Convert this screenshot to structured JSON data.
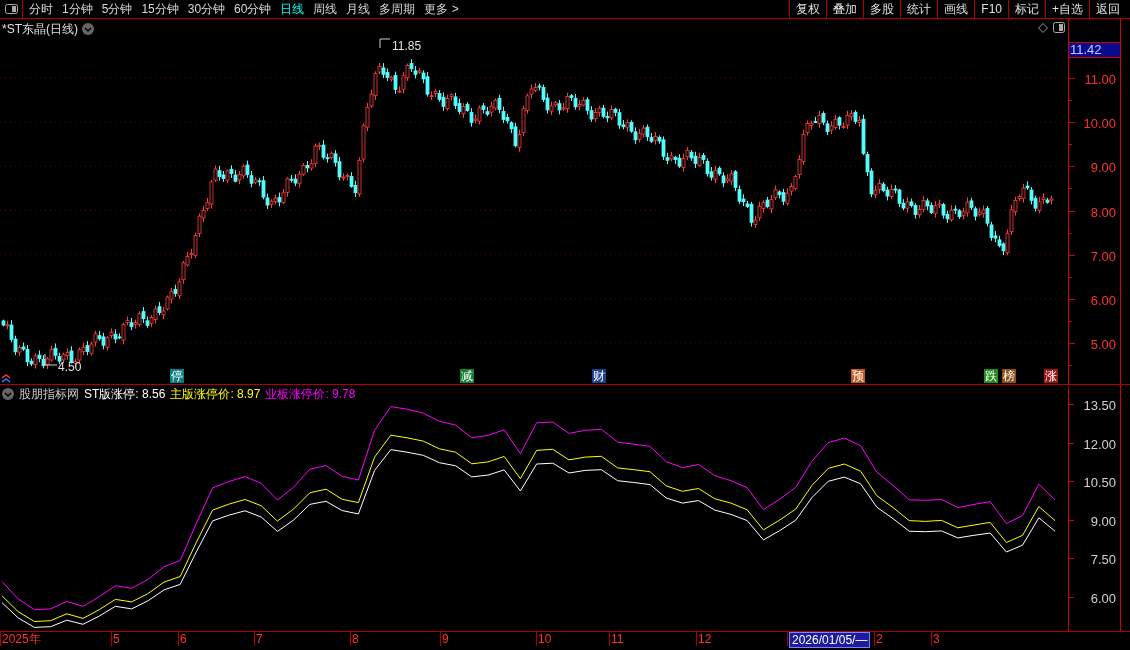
{
  "toolbar": {
    "periods": [
      {
        "label": "分时",
        "selected": false
      },
      {
        "label": "1分钟",
        "selected": false
      },
      {
        "label": "5分钟",
        "selected": false
      },
      {
        "label": "15分钟",
        "selected": false
      },
      {
        "label": "30分钟",
        "selected": false
      },
      {
        "label": "60分钟",
        "selected": false
      },
      {
        "label": "日线",
        "selected": true
      },
      {
        "label": "周线",
        "selected": false
      },
      {
        "label": "月线",
        "selected": false
      },
      {
        "label": "多周期",
        "selected": false
      },
      {
        "label": "更多 >",
        "selected": false
      }
    ],
    "actions": [
      "复权",
      "叠加",
      "多股",
      "统计",
      "画线",
      "F10",
      "标记",
      "+自选",
      "返回"
    ]
  },
  "chart": {
    "title": "*ST东晶(日线)",
    "current_price": "11.42",
    "price_axis": [
      "11.00",
      "10.00",
      "9.00",
      "8.00",
      "7.00",
      "6.00",
      "5.00"
    ],
    "high_label": "11.85",
    "low_label": "4.50",
    "markers": [
      {
        "text": "停",
        "color": "#0a7f80"
      },
      {
        "text": "减",
        "color": "#128030"
      },
      {
        "text": "财",
        "color": "#1c3f8c"
      },
      {
        "text": "预",
        "color": "#c0581a"
      },
      {
        "text": "跌",
        "color": "#1c8c1c"
      },
      {
        "text": "榜",
        "color": "#8c4c14"
      },
      {
        "text": "涨",
        "color": "#9a1418"
      }
    ]
  },
  "indicator": {
    "name": "股朋指标网",
    "legend": [
      ": 8.56",
      ": 8.97",
      ": 9.78"
    ],
    "chart_data": {
      "type": "line",
      "ylim": [
        4.72,
        14.24
      ],
      "yticks": [
        {
          "value": 13.5,
          "label": "13.50"
        },
        {
          "value": 12,
          "label": "12.00"
        },
        {
          "value": 10.5,
          "label": "10.50"
        },
        {
          "value": 9,
          "label": "9.00"
        },
        {
          "value": 7.5,
          "label": "7.50"
        },
        {
          "value": 6,
          "label": "6.00"
        }
      ],
      "series": [
        {
          "name": "ST版涨停",
          "color": "#ffffff",
          "values": [
            5.78,
            5.19,
            4.82,
            4.85,
            5.1,
            4.94,
            5.26,
            5.64,
            5.54,
            5.85,
            6.28,
            6.49,
            7.76,
            8.96,
            9.18,
            9.35,
            9.11,
            8.55,
            8.99,
            9.6,
            9.72,
            9.36,
            9.23,
            10.92,
            11.73,
            11.63,
            11.51,
            11.22,
            11.1,
            10.67,
            10.74,
            10.94,
            10.12,
            11.17,
            11.2,
            10.82,
            10.92,
            10.95,
            10.52,
            10.45,
            10.37,
            9.85,
            9.65,
            9.75,
            9.38,
            9.21,
            8.97,
            8.22,
            8.58,
            8.99,
            9.87,
            10.5,
            10.66,
            10.4,
            9.49,
            9.05,
            8.56,
            8.54,
            8.57,
            8.3,
            8.4,
            8.49,
            7.75,
            8.02,
            9.08,
            8.56
          ]
        },
        {
          "name": "主版涨停价",
          "color": "#ffff00",
          "values": [
            6.05,
            5.43,
            5.05,
            5.08,
            5.35,
            5.17,
            5.51,
            5.91,
            5.81,
            6.13,
            6.58,
            6.8,
            8.13,
            9.38,
            9.61,
            9.79,
            9.55,
            8.95,
            9.42,
            10.05,
            10.19,
            9.8,
            9.67,
            11.44,
            12.29,
            12.19,
            12.06,
            11.76,
            11.63,
            11.18,
            11.25,
            11.46,
            10.6,
            11.7,
            11.74,
            11.33,
            11.44,
            11.47,
            11.02,
            10.95,
            10.87,
            10.32,
            10.11,
            10.22,
            9.82,
            9.65,
            9.39,
            8.61,
            8.99,
            9.42,
            10.34,
            11.0,
            11.17,
            10.89,
            9.94,
            9.48,
            8.97,
            8.94,
            8.98,
            8.69,
            8.8,
            8.9,
            8.12,
            8.4,
            9.52,
            8.97
          ]
        },
        {
          "name": "业板涨停价",
          "color": "#ff00ff",
          "values": [
            6.6,
            5.93,
            5.51,
            5.54,
            5.83,
            5.64,
            6.01,
            6.44,
            6.34,
            6.68,
            7.18,
            7.42,
            8.87,
            10.24,
            10.49,
            10.68,
            10.42,
            9.77,
            10.27,
            10.97,
            11.11,
            10.69,
            10.55,
            12.48,
            13.4,
            13.3,
            13.15,
            12.83,
            12.68,
            12.19,
            12.28,
            12.5,
            11.57,
            12.77,
            12.8,
            12.36,
            12.48,
            12.52,
            12.02,
            11.94,
            11.86,
            11.26,
            11.03,
            11.15,
            10.72,
            10.52,
            10.25,
            9.4,
            9.8,
            10.27,
            11.28,
            12.0,
            12.18,
            11.88,
            10.85,
            10.34,
            9.78,
            9.76,
            9.79,
            9.48,
            9.6,
            9.71,
            8.86,
            9.17,
            10.38,
            9.78
          ]
        }
      ]
    }
  },
  "date_axis": [
    {
      "label": "2025年",
      "selected": false
    },
    {
      "label": "5",
      "selected": false
    },
    {
      "label": "6",
      "selected": false
    },
    {
      "label": "7",
      "selected": false
    },
    {
      "label": "8",
      "selected": false
    },
    {
      "label": "9",
      "selected": false
    },
    {
      "label": "10",
      "selected": false
    },
    {
      "label": "11",
      "selected": false
    },
    {
      "label": "12",
      "selected": false
    },
    {
      "label": "2026/01/05/—",
      "selected": true
    },
    {
      "label": "2",
      "selected": false
    },
    {
      "label": "3",
      "selected": false
    }
  ]
}
